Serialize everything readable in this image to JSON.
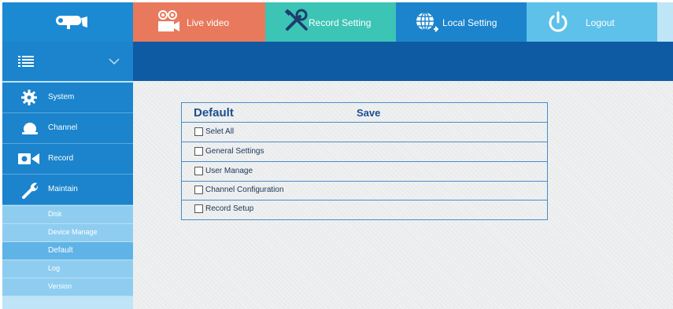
{
  "header": {
    "tabs": [
      {
        "label": "Live video",
        "icon": "camera-icon",
        "color": "#e9795c"
      },
      {
        "label": "Record Setting",
        "icon": "tools-icon",
        "color": "#3cc4b5"
      },
      {
        "label": "Local Setting",
        "icon": "globe-icon",
        "color": "#1b84cc"
      },
      {
        "label": "Logout",
        "icon": "power-icon",
        "color": "#5ec1ea"
      }
    ]
  },
  "sidebar": {
    "items": [
      {
        "label": "System",
        "icon": "gear-icon"
      },
      {
        "label": "Channel",
        "icon": "dome-camera-icon"
      },
      {
        "label": "Record",
        "icon": "record-icon"
      },
      {
        "label": "Maintain",
        "icon": "wrench-icon"
      }
    ],
    "subitems": [
      {
        "label": "Disk"
      },
      {
        "label": "Device Manage"
      },
      {
        "label": "Default",
        "active": true
      },
      {
        "label": "Log"
      },
      {
        "label": "Version"
      }
    ]
  },
  "panel": {
    "title": "Default",
    "save_label": "Save",
    "options": [
      {
        "label": "Selet All",
        "checked": false
      },
      {
        "label": "General Settings",
        "checked": false
      },
      {
        "label": "User Manage",
        "checked": false
      },
      {
        "label": "Channel Configuration",
        "checked": false
      },
      {
        "label": "Record Setup",
        "checked": false
      }
    ]
  }
}
